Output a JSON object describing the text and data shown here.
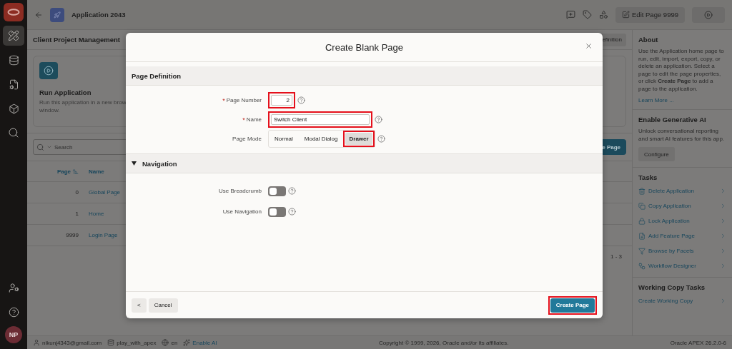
{
  "sidebar": {
    "nav_items": [
      {
        "kind": "tools",
        "selected": true
      },
      {
        "kind": "database",
        "selected": false
      },
      {
        "kind": "document",
        "selected": false
      },
      {
        "kind": "package",
        "selected": false
      },
      {
        "kind": "search",
        "selected": false
      }
    ],
    "avatar": "NP"
  },
  "header": {
    "app_title": "Application 2043",
    "edit_button": "Edit Page 9999"
  },
  "page": {
    "title": "Client Project Management",
    "definition_button": "efinition",
    "card": {
      "title": "Run Application",
      "description_lines": [
        "Run this application in a new brow",
        "window."
      ]
    },
    "search_placeholder": "Search",
    "create_button": "e Page",
    "table": {
      "columns": [
        "Page",
        "Name"
      ],
      "rows": [
        {
          "page": "0",
          "name": "Global Page"
        },
        {
          "page": "1",
          "name": "Home"
        },
        {
          "page": "9999",
          "name": "Login Page"
        }
      ]
    },
    "pagination": "1 - 3"
  },
  "about": {
    "title": "About",
    "text": "Use the Application home page to run, edit, import, export, copy, or delete an application. Select a page to edit the page properties, or click **Create Page** to add a page to the application.",
    "link": "Learn More ..."
  },
  "generative_ai": {
    "title": "Enable Generative AI",
    "text": "Unlock conversational reporting and smart AI features for this app.",
    "button": "Configure"
  },
  "tasks": {
    "title": "Tasks",
    "items": [
      {
        "kind": "trash",
        "label": "Delete Application"
      },
      {
        "kind": "copy",
        "label": "Copy Application"
      },
      {
        "kind": "lock",
        "label": "Lock Application"
      },
      {
        "kind": "file",
        "label": "Add Feature Page"
      },
      {
        "kind": "funnel",
        "label": "Browse by Facets"
      },
      {
        "kind": "workflow",
        "label": "Workflow Designer"
      }
    ]
  },
  "working_copy": {
    "title": "Working Copy Tasks",
    "items": [
      "Create Working Copy"
    ]
  },
  "footer": {
    "user": "nikunj4343@gmail.com",
    "workspace": "play_with_apex",
    "language": "en",
    "ai_link": "Enable AI",
    "copyright": "Copyright © 1999, 2026, Oracle and/or its affiliates.",
    "version": "Oracle APEX 26.2.0-6"
  },
  "dialog": {
    "title": "Create Blank Page",
    "page_definition": {
      "title": "Page Definition",
      "page_number": {
        "label": "Page Number",
        "value": "2",
        "required_marker": "*",
        "highlighted": true
      },
      "name": {
        "label": "Name",
        "value": "Switch Client",
        "required_marker": "*",
        "highlighted": true
      },
      "page_mode": {
        "label": "Page Mode",
        "options": [
          {
            "label": "Normal",
            "selected": false,
            "highlighted": false
          },
          {
            "label": "Modal Dialog",
            "selected": false,
            "highlighted": false
          },
          {
            "label": "Drawer",
            "selected": true,
            "highlighted": true
          }
        ]
      }
    },
    "navigation": {
      "title": "Navigation",
      "expanded": true,
      "switches": [
        {
          "label": "Use Breadcrumb",
          "on": false
        },
        {
          "label": "Use Navigation",
          "on": false
        }
      ]
    },
    "back_button": "<",
    "cancel_button": "Cancel",
    "create_button": {
      "label": "Create Page",
      "highlighted": true
    }
  }
}
